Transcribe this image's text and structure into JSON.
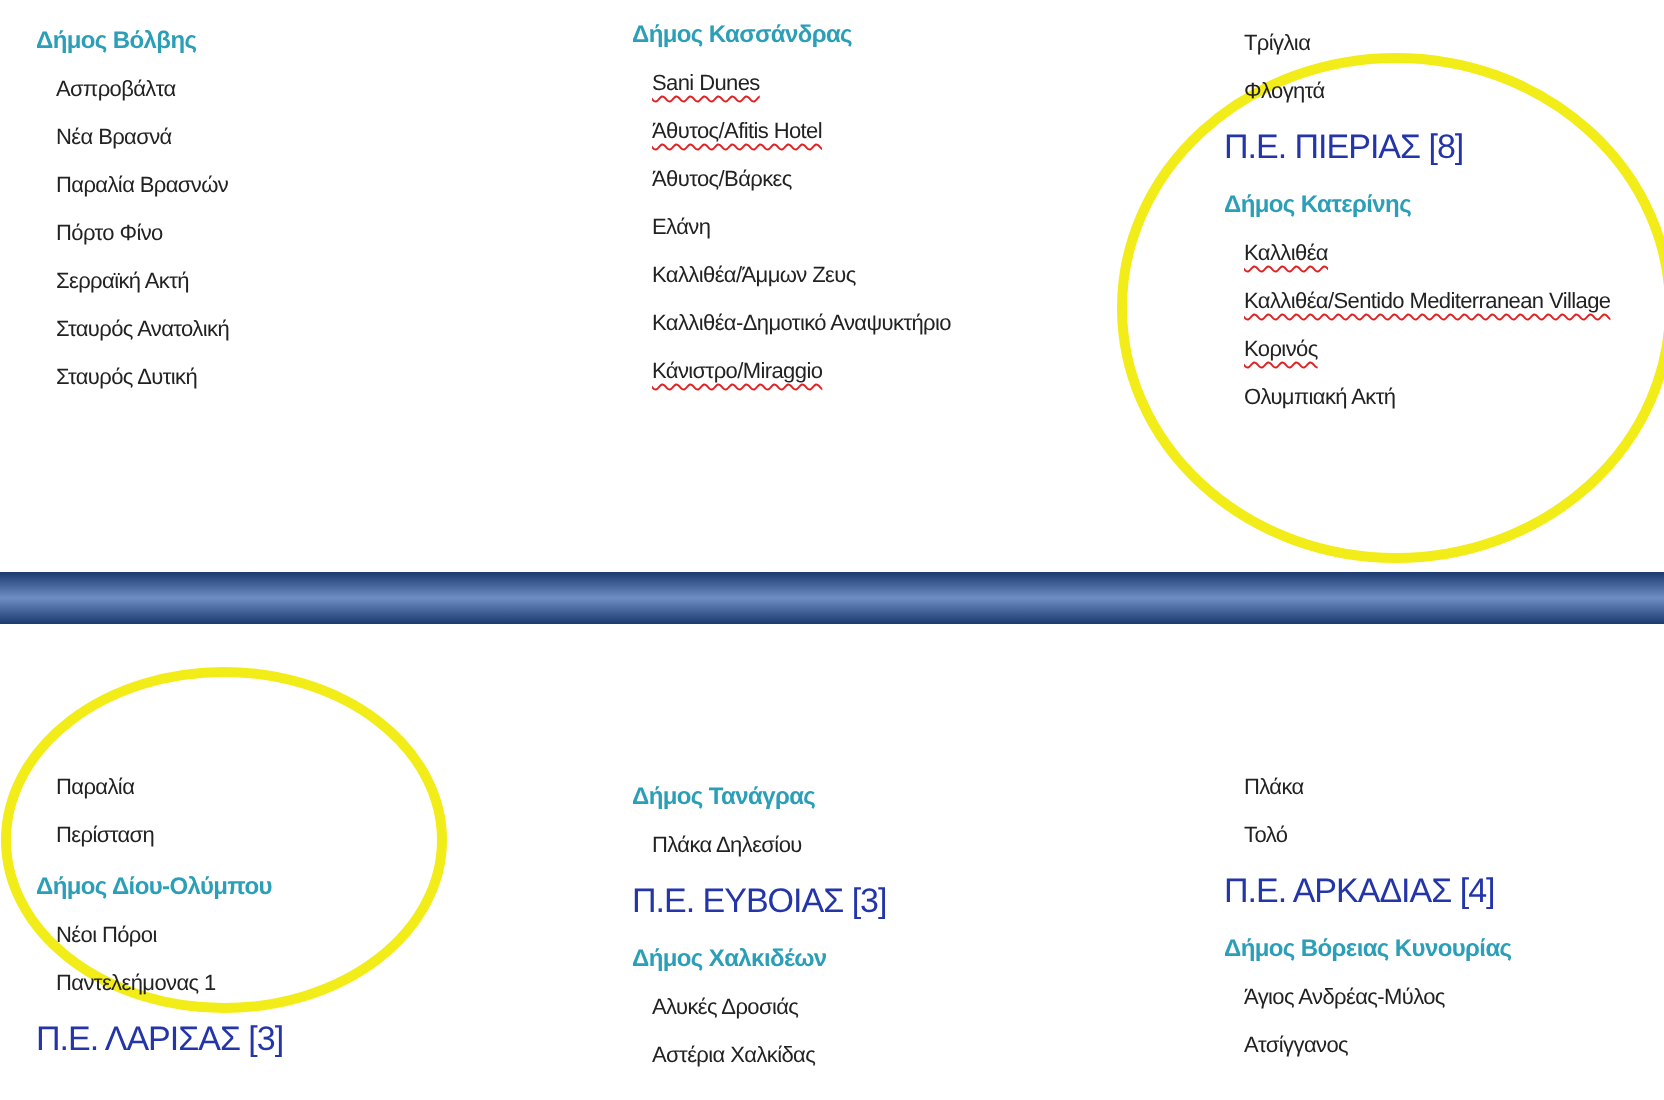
{
  "panels": [
    {
      "columns": [
        {
          "entries": [
            {
              "kind": "municipality",
              "text": "Δήμος Βόλβης"
            },
            {
              "kind": "place",
              "text": "Ασπροβάλτα",
              "flagged": false
            },
            {
              "kind": "place",
              "text": "Νέα Βρασνά",
              "flagged": false
            },
            {
              "kind": "place",
              "text": "Παραλία Βρασνών",
              "flagged": false
            },
            {
              "kind": "place",
              "text": "Πόρτο Φίνο",
              "flagged": false
            },
            {
              "kind": "place",
              "text": "Σερραϊκή Ακτή",
              "flagged": false
            },
            {
              "kind": "place",
              "text": "Σταυρός Ανατολική",
              "flagged": false
            },
            {
              "kind": "place",
              "text": "Σταυρός Δυτική",
              "flagged": false
            }
          ]
        },
        {
          "entries": [
            {
              "kind": "municipality",
              "text": "Δήμος Κασσάνδρας"
            },
            {
              "kind": "place",
              "text": "Sani Dunes",
              "flagged": true
            },
            {
              "kind": "place",
              "text": "Άθυτος/Afitis Hotel",
              "flagged": true
            },
            {
              "kind": "place",
              "text": "Άθυτος/Βάρκες",
              "flagged": false
            },
            {
              "kind": "place",
              "text": "Ελάνη",
              "flagged": false
            },
            {
              "kind": "place",
              "text": "Καλλιθέα/Άμμων Ζευς",
              "flagged": false
            },
            {
              "kind": "place",
              "text": "Καλλιθέα-Δημοτικό Αναψυκτήριο",
              "flagged": false
            },
            {
              "kind": "place",
              "text": "Κάνιστρο/Miraggio",
              "flagged": true
            }
          ]
        },
        {
          "highlighted": true,
          "entries": [
            {
              "kind": "place",
              "text": "Τρίγλια",
              "flagged": false
            },
            {
              "kind": "place",
              "text": "Φλογητά",
              "flagged": false
            },
            {
              "kind": "region",
              "text": "Π.Ε. ΠΙΕΡΙΑΣ [8]"
            },
            {
              "kind": "municipality",
              "text": "Δήμος Κατερίνης"
            },
            {
              "kind": "place",
              "text": "Καλλιθέα",
              "flagged": true
            },
            {
              "kind": "place",
              "text": "Καλλιθέα/Sentido Mediterranean Village",
              "flagged": true
            },
            {
              "kind": "place",
              "text": "Κορινός",
              "flagged": true
            },
            {
              "kind": "place",
              "text": "Ολυμπιακή Ακτή",
              "flagged": false
            }
          ]
        }
      ]
    },
    {
      "columns": [
        {
          "highlighted": true,
          "entries": [
            {
              "kind": "place",
              "text": "Παραλία",
              "flagged": false
            },
            {
              "kind": "place",
              "text": "Περίσταση",
              "flagged": false
            },
            {
              "kind": "municipality",
              "text": "Δήμος Δίου-Ολύμπου"
            },
            {
              "kind": "place",
              "text": "Νέοι Πόροι",
              "flagged": false
            },
            {
              "kind": "place",
              "text": "Παντελεήμονας 1",
              "flagged": false
            },
            {
              "kind": "region",
              "text": "Π.Ε. ΛΑΡΙΣΑΣ [3]"
            }
          ]
        },
        {
          "entries": [
            {
              "kind": "municipality",
              "text": "Δήμος Τανάγρας"
            },
            {
              "kind": "place",
              "text": "Πλάκα Δηλεσίου",
              "flagged": false
            },
            {
              "kind": "region",
              "text": "Π.Ε. ΕΥΒΟΙΑΣ [3]"
            },
            {
              "kind": "municipality",
              "text": "Δήμος Χαλκιδέων"
            },
            {
              "kind": "place",
              "text": "Αλυκές Δροσιάς",
              "flagged": false
            },
            {
              "kind": "place",
              "text": "Αστέρια Χαλκίδας",
              "flagged": false
            }
          ]
        },
        {
          "entries": [
            {
              "kind": "place",
              "text": "Πλάκα",
              "flagged": false
            },
            {
              "kind": "place",
              "text": "Τολό",
              "flagged": false
            },
            {
              "kind": "region",
              "text": "Π.Ε. ΑΡΚΑΔΙΑΣ [4]"
            },
            {
              "kind": "municipality",
              "text": "Δήμος Βόρειας Κυνουρίας"
            },
            {
              "kind": "place",
              "text": "Άγιος Ανδρέας-Μύλος",
              "flagged": false
            },
            {
              "kind": "place",
              "text": "Ατσίγγανος",
              "flagged": false
            }
          ]
        }
      ]
    }
  ]
}
